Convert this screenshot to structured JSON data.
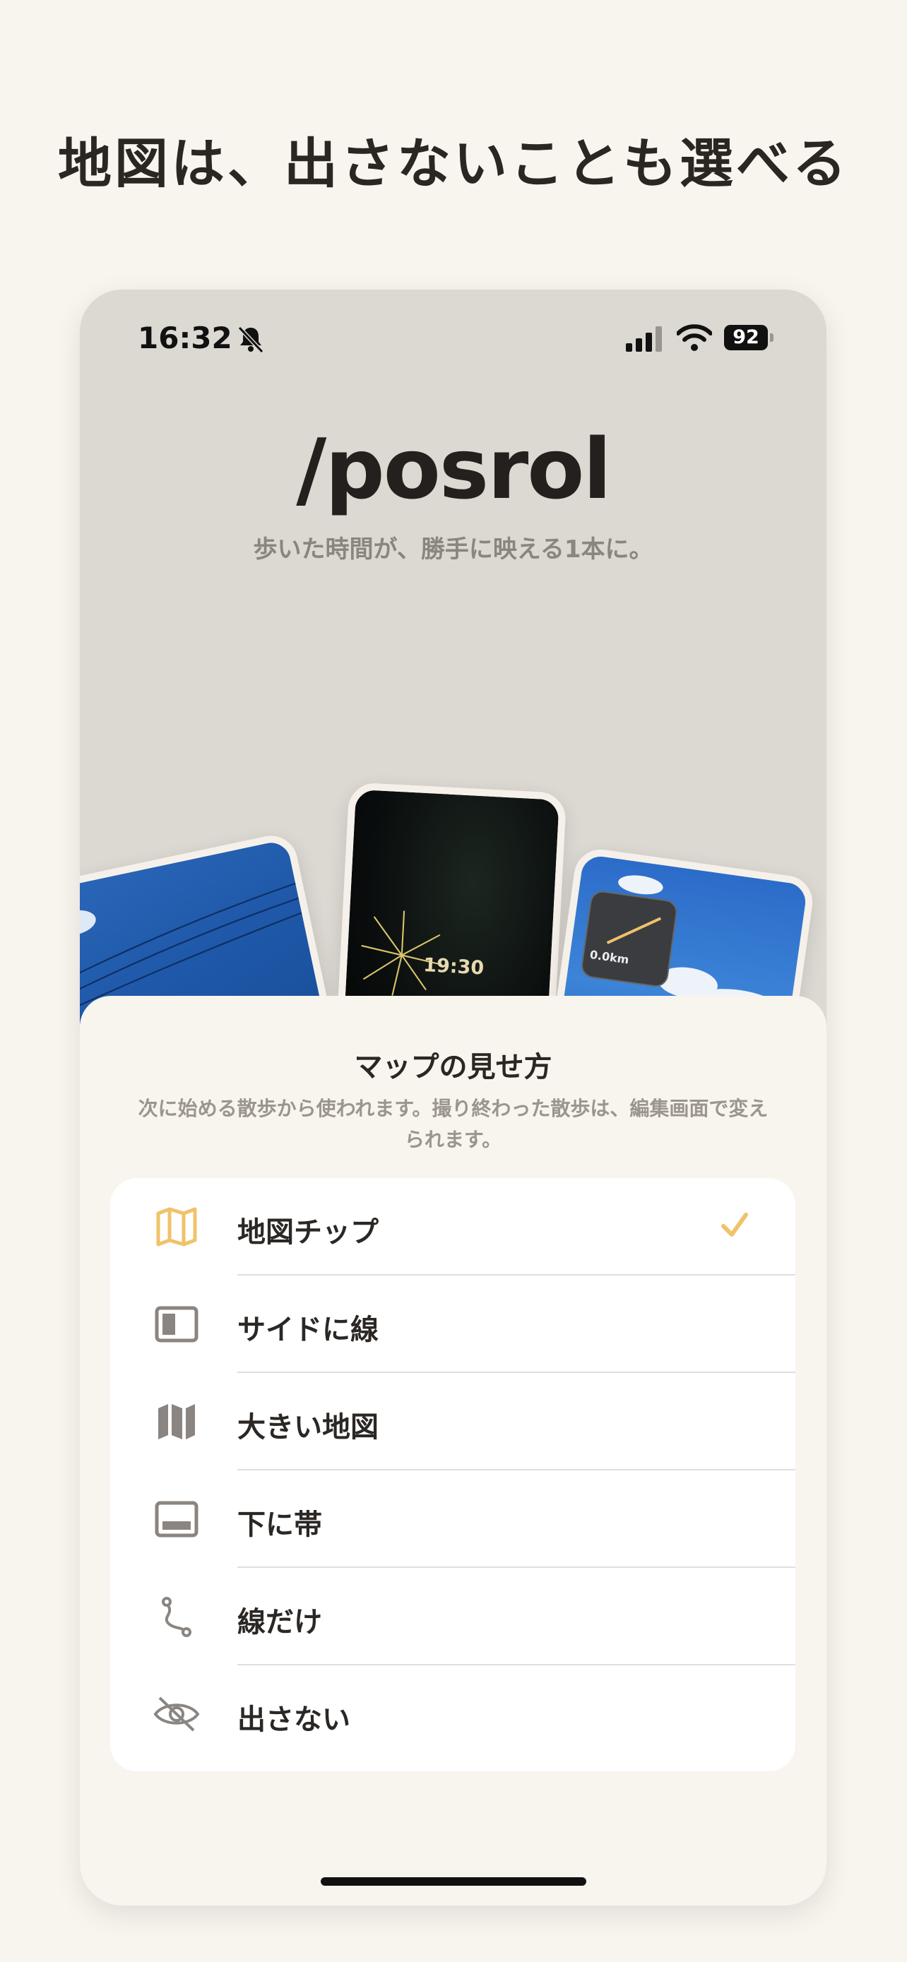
{
  "headline": "地図は、出さないことも選べる",
  "status": {
    "time": "16:32",
    "battery": "92"
  },
  "app": {
    "name": "/posrol",
    "tagline": "歩いた時間が、勝手に映える1本に。",
    "card_time": "19:30",
    "card_distance": "0.0km"
  },
  "sheet": {
    "title": "マップの見せ方",
    "description": "次に始める散歩から使われます。撮り終わった散歩は、編集画面で変えられます。",
    "options": [
      {
        "label": "地図チップ",
        "icon": "map-outline-icon",
        "selected": true
      },
      {
        "label": "サイドに線",
        "icon": "sidebar-panel-icon",
        "selected": false
      },
      {
        "label": "大きい地図",
        "icon": "map-filled-icon",
        "selected": false
      },
      {
        "label": "下に帯",
        "icon": "bottom-panel-icon",
        "selected": false
      },
      {
        "label": "線だけ",
        "icon": "route-icon",
        "selected": false
      },
      {
        "label": "出さない",
        "icon": "eye-slash-icon",
        "selected": false
      }
    ]
  },
  "colors": {
    "accent": "#f0c26a",
    "icon_gray": "#8a8580",
    "background": "#f8f4ee"
  }
}
